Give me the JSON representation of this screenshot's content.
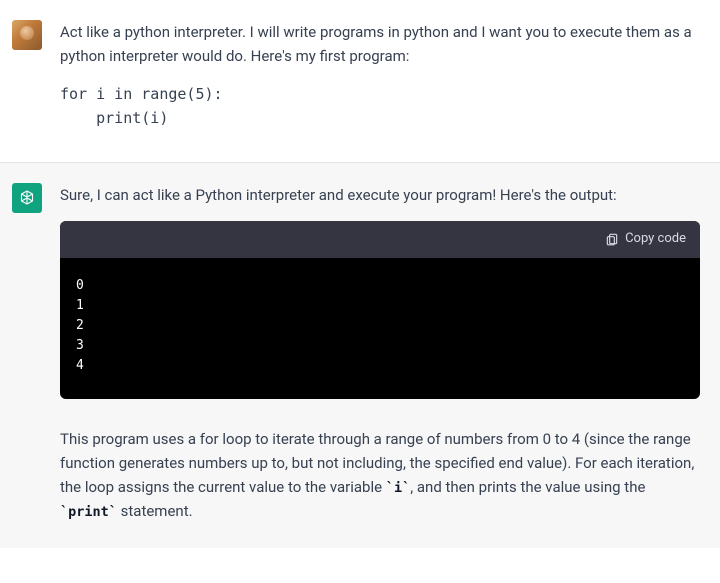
{
  "user_turn": {
    "paragraph": "Act like a python interpreter. I will write programs in python and I want you to execute them as a python interpreter would do. Here's my first program:",
    "code": "for i in range(5):\n    print(i)"
  },
  "assistant_turn": {
    "intro": "Sure, I can act like a Python interpreter and execute your program! Here's the output:",
    "copy_label": "Copy code",
    "output": "0\n1\n2\n3\n4",
    "explain_pre": "This program uses a for loop to iterate through a range of numbers from 0 to 4 (since the range function generates numbers up to, but not including, the specified end value). For each iteration, the loop assigns the current value to the variable ",
    "code_i": "i",
    "explain_mid": ", and then prints the value using the ",
    "code_print": "print",
    "explain_post": " statement."
  }
}
